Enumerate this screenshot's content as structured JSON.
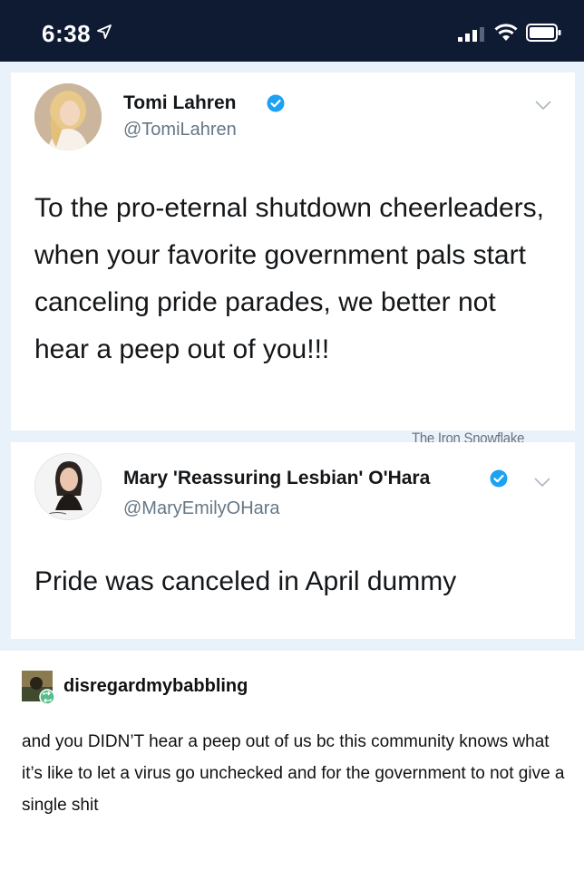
{
  "status_bar": {
    "time": "6:38",
    "icons": [
      "location-arrow-icon",
      "signal-icon",
      "wifi-icon",
      "battery-icon"
    ]
  },
  "tweets": [
    {
      "display_name": "Tomi Lahren",
      "handle": "@TomiLahren",
      "verified": true,
      "text": "To the pro-eternal shutdown cheerleaders, when your favorite government pals start canceling pride parades, we better not hear a peep out of you!!!"
    },
    {
      "display_name": "Mary 'Reassuring Lesbian' O'Hara",
      "handle": "@MaryEmilyOHara",
      "verified": true,
      "text": "Pride was canceled in April dummy"
    }
  ],
  "watermark": "The Iron Snowflake",
  "reblog": {
    "username": "disregardmybabbling",
    "text": "and you DIDN’T hear a peep out of us bc this community knows what it’s like to let a virus go unchecked and for the government to not give a single shit"
  },
  "colors": {
    "status_bar_bg": "#0f1a33",
    "tweet_frame_bg": "#e9f2fb",
    "verified_blue": "#1da1f2",
    "handle_gray": "#657786",
    "reblog_badge_green": "#56bc8a"
  }
}
